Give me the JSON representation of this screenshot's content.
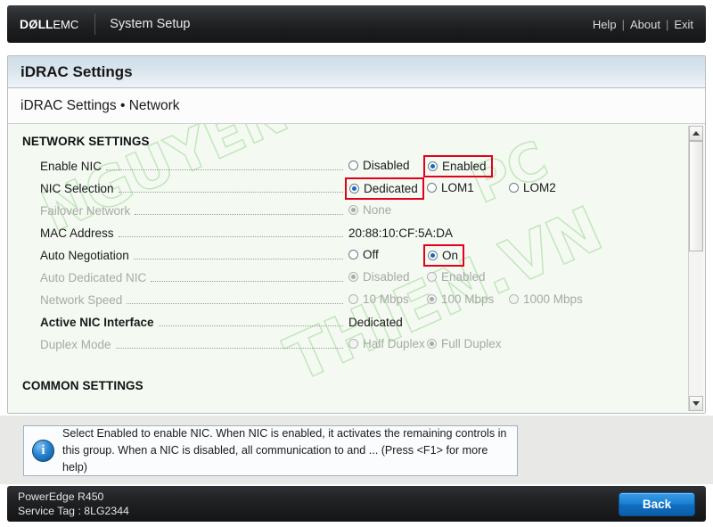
{
  "header": {
    "logo": "DELLEMC",
    "logo_prefix": "D",
    "logo_mid": "LL",
    "logo_suffix": "EMC",
    "app_title": "System Setup",
    "links": [
      {
        "label": "Help",
        "name": "help-link"
      },
      {
        "label": "About",
        "name": "about-link"
      },
      {
        "label": "Exit",
        "name": "exit-link"
      }
    ],
    "separator": "|"
  },
  "page": {
    "title": "iDRAC Settings",
    "breadcrumb": "iDRAC Settings • Network"
  },
  "watermark": {
    "line1": "NGUYEN",
    "line2": "THIEN.VN",
    "line3": "PC"
  },
  "groups": [
    {
      "heading": "NETWORK SETTINGS",
      "rows": [
        {
          "label": "Enable NIC",
          "type": "radio",
          "disabled": false,
          "bold": false,
          "options": [
            {
              "label": "Disabled",
              "selected": false,
              "highlight": false
            },
            {
              "label": "Enabled",
              "selected": true,
              "highlight": true
            }
          ]
        },
        {
          "label": "NIC Selection",
          "type": "radio",
          "disabled": false,
          "bold": false,
          "options": [
            {
              "label": "Dedicated",
              "selected": true,
              "highlight": true
            },
            {
              "label": "LOM1",
              "selected": false,
              "highlight": false
            },
            {
              "label": "LOM2",
              "selected": false,
              "highlight": false
            }
          ]
        },
        {
          "label": "Failover Network",
          "type": "radio",
          "disabled": true,
          "bold": false,
          "options": [
            {
              "label": "None",
              "selected": true,
              "highlight": false
            }
          ]
        },
        {
          "label": "MAC Address",
          "type": "text",
          "disabled": false,
          "bold": false,
          "value": "20:88:10:CF:5A:DA"
        },
        {
          "label": "Auto Negotiation",
          "type": "radio",
          "disabled": false,
          "bold": false,
          "options": [
            {
              "label": "Off",
              "selected": false,
              "highlight": false
            },
            {
              "label": "On",
              "selected": true,
              "highlight": true
            }
          ]
        },
        {
          "label": "Auto Dedicated NIC",
          "type": "radio",
          "disabled": true,
          "bold": false,
          "options": [
            {
              "label": "Disabled",
              "selected": true,
              "highlight": false
            },
            {
              "label": "Enabled",
              "selected": false,
              "highlight": false
            }
          ]
        },
        {
          "label": "Network Speed",
          "type": "radio",
          "disabled": true,
          "bold": false,
          "options": [
            {
              "label": "10 Mbps",
              "selected": false,
              "highlight": false
            },
            {
              "label": "100 Mbps",
              "selected": true,
              "highlight": false
            },
            {
              "label": "1000 Mbps",
              "selected": false,
              "highlight": false
            }
          ]
        },
        {
          "label": "Active NIC Interface",
          "type": "text",
          "disabled": false,
          "bold": true,
          "value": "Dedicated"
        },
        {
          "label": "Duplex Mode",
          "type": "radio",
          "disabled": true,
          "bold": false,
          "options": [
            {
              "label": "Half Duplex",
              "selected": false,
              "highlight": false
            },
            {
              "label": "Full Duplex",
              "selected": true,
              "highlight": false
            }
          ]
        }
      ]
    },
    {
      "heading": "COMMON SETTINGS",
      "rows": []
    }
  ],
  "help": {
    "icon": "info-icon",
    "text": "Select Enabled to enable NIC. When NIC is enabled, it activates the remaining controls in this group. When a NIC is disabled, all communication to and ... (Press <F1> for more help)"
  },
  "footer": {
    "model": "PowerEdge R450",
    "service_tag": "Service Tag : 8LG2344",
    "back_label": "Back"
  },
  "colors": {
    "accent_blue": "#1669c0",
    "highlight_red": "#e4001b",
    "panel_bg": "#f4f9f2",
    "watermark_green": "#96d68a"
  }
}
